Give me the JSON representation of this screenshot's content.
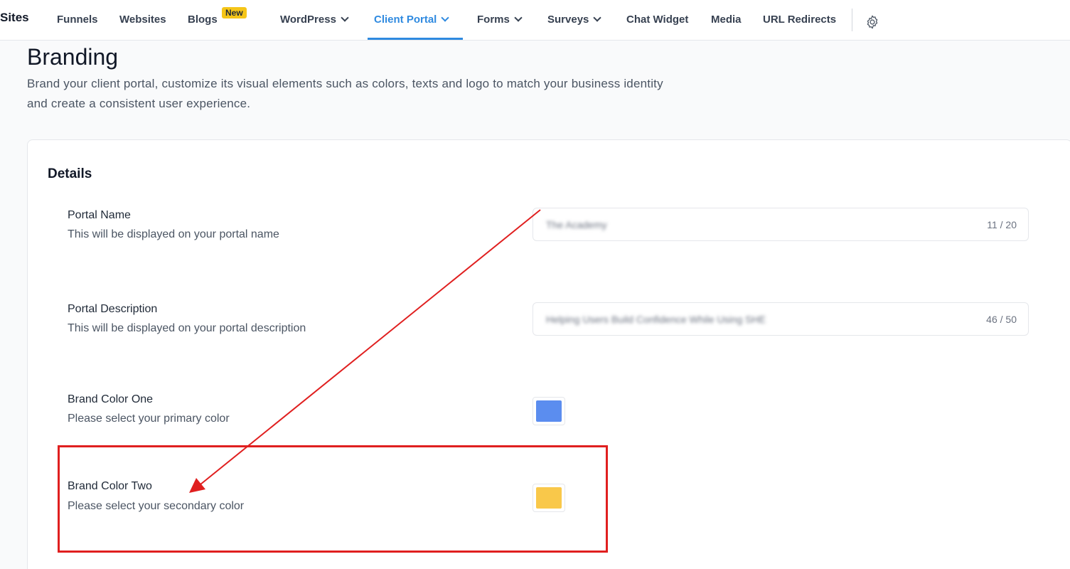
{
  "nav": {
    "app_title": "Sites",
    "items": [
      {
        "label": "Funnels"
      },
      {
        "label": "Websites"
      },
      {
        "label": "Blogs"
      },
      {
        "label": "WordPress"
      },
      {
        "label": "Client Portal"
      },
      {
        "label": "Forms"
      },
      {
        "label": "Surveys"
      },
      {
        "label": "Chat Widget"
      },
      {
        "label": "Media"
      },
      {
        "label": "URL Redirects"
      }
    ],
    "new_badge": "New",
    "active_color": "#2f8ae0",
    "settings_icon": "gear-icon"
  },
  "header": {
    "title": "Branding",
    "description": "Brand your client portal, customize its visual elements such as colors, texts and logo to match your business identity and create a consistent user experience."
  },
  "details": {
    "title": "Details",
    "portal_name": {
      "label": "Portal Name",
      "help": "This will be displayed on your portal name",
      "value": "The Academy",
      "counter": "11 / 20"
    },
    "portal_description": {
      "label": "Portal Description",
      "help": "This will be displayed on your portal description",
      "value": "Helping Users Build Confidence While Using SHE",
      "counter": "46 / 50"
    },
    "brand_color_one": {
      "label": "Brand Color One",
      "help": "Please select your primary color",
      "color": "#5b8def"
    },
    "brand_color_two": {
      "label": "Brand Color Two",
      "help": "Please select your secondary color",
      "color": "#f9c84a"
    }
  },
  "annotation": {
    "color": "#e01f1f"
  }
}
